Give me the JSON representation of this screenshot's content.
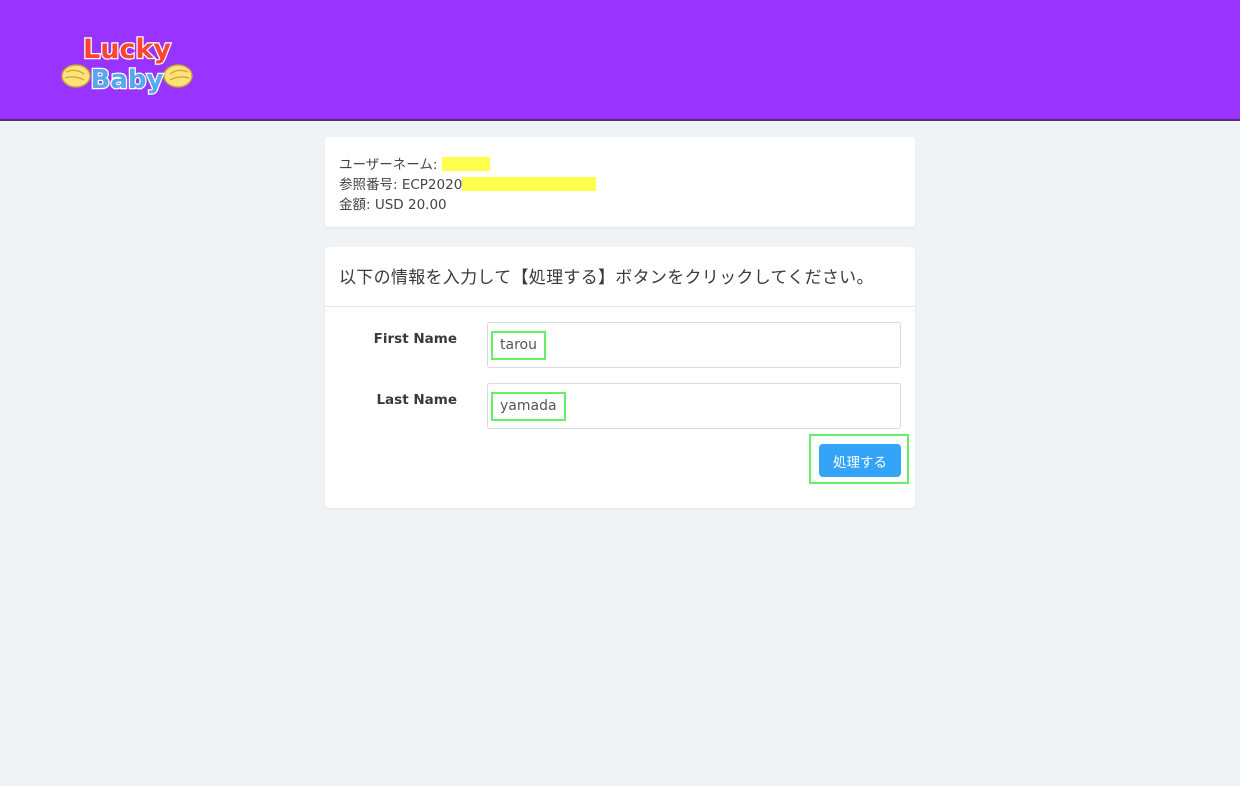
{
  "brand": {
    "logo_line1": "Lucky",
    "logo_line2": "Baby",
    "header_color": "#9933ff"
  },
  "order_info": {
    "username_label": "ユーザーネーム:",
    "reference_label": "参照番号: ECP2020",
    "amount_label": "金額: USD 20.00"
  },
  "form": {
    "instruction": "以下の情報を入力して【処理する】ボタンをクリックしてください。",
    "first_name_label": "First Name",
    "first_name_value": "tarou",
    "last_name_label": "Last Name",
    "last_name_value": "yamada",
    "submit_label": "処理する",
    "submit_color": "#33a4f7",
    "highlight_color": "#66ee66"
  }
}
